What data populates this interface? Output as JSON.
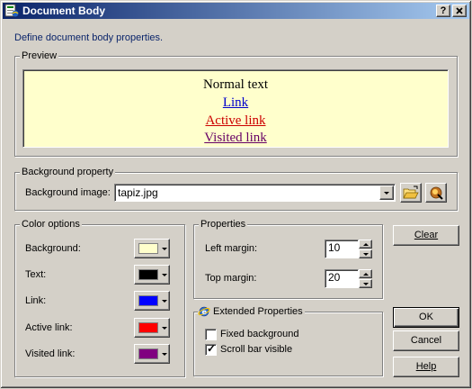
{
  "window": {
    "title": "Document Body",
    "help_button": "?",
    "close_button": "✕"
  },
  "description": "Define document body properties.",
  "preview": {
    "group_label": "Preview",
    "normal_text": "Normal text",
    "link_text": "Link",
    "active_link_text": "Active link",
    "visited_link_text": "Visited link",
    "background_color": "#ffffcc",
    "text_color": "#000000",
    "link_color": "#0000cc",
    "active_color": "#cc0000",
    "visited_color": "#660066"
  },
  "background_property": {
    "group_label": "Background property",
    "image_label": "Background image:",
    "image_value": "tapiz.jpg",
    "browse_icon": "open-folder-icon",
    "image_props_icon": "image-properties-icon"
  },
  "color_options": {
    "group_label": "Color options",
    "items": [
      {
        "label": "Background:",
        "color": "#ffffcc"
      },
      {
        "label": "Text:",
        "color": "#000000"
      },
      {
        "label": "Link:",
        "color": "#0000ff"
      },
      {
        "label": "Active link:",
        "color": "#ff0000"
      },
      {
        "label": "Visited link:",
        "color": "#800080"
      }
    ]
  },
  "properties": {
    "group_label": "Properties",
    "left_margin_label": "Left margin:",
    "left_margin_value": "10",
    "top_margin_label": "Top margin:",
    "top_margin_value": "20"
  },
  "extended": {
    "group_label": "Extended Properties",
    "icon": "ie-globe-icon",
    "fixed_background_label": "Fixed background",
    "fixed_background_checked": false,
    "scroll_bar_label": "Scroll bar visible",
    "scroll_bar_checked": true
  },
  "buttons": {
    "clear": "Clear",
    "ok": "OK",
    "cancel": "Cancel",
    "help": "Help"
  }
}
